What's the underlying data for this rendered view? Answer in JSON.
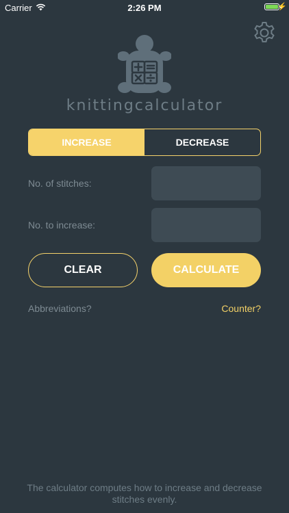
{
  "status_bar": {
    "carrier": "Carrier",
    "time": "2:26 PM",
    "battery_level": 1.0,
    "battery_color": "#7ed957"
  },
  "header": {
    "settings_icon": "gear-icon",
    "logo_icon": "turtle-calculator-logo",
    "app_name": "knittingcalculator"
  },
  "mode_tabs": {
    "increase_label": "INCREASE",
    "decrease_label": "DECREASE",
    "selected": "INCREASE"
  },
  "form": {
    "stitches_label": "No. of stitches:",
    "stitches_value": "",
    "increase_label": "No. to increase:",
    "increase_value": ""
  },
  "actions": {
    "clear_label": "CLEAR",
    "calculate_label": "CALCULATE"
  },
  "links": {
    "abbreviations": "Abbreviations?",
    "counter": "Counter?"
  },
  "footer": {
    "description": "The calculator computes how to increase and decrease stitches evenly."
  },
  "colors": {
    "background": "#2c373f",
    "accent": "#f6d36b",
    "muted_text": "#7e8b93",
    "input_bg": "#3e4b54"
  }
}
